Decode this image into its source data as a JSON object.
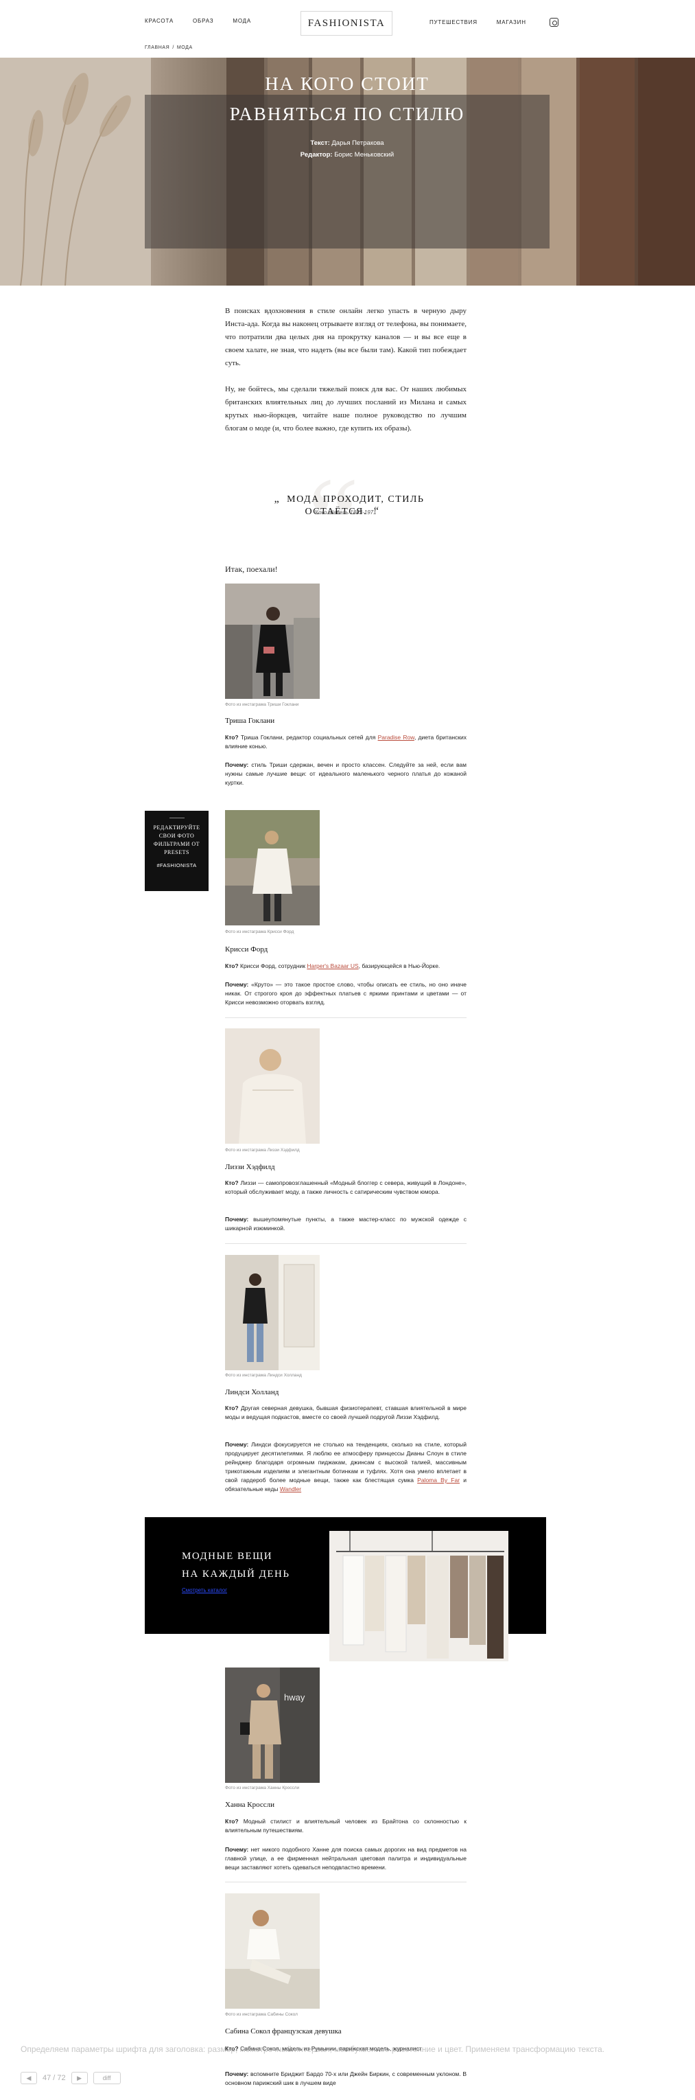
{
  "header": {
    "nav_left": [
      "КРАСОТА",
      "ОБРАЗ",
      "МОДА"
    ],
    "logo": "FASHIONISTA",
    "nav_right": [
      "ПУТЕШЕСТВИЯ",
      "МАГАЗИН"
    ],
    "breadcrumb": [
      "ГЛАВНАЯ",
      "МОДА"
    ]
  },
  "hero": {
    "title_line1": "НА КОГО СТОИТ",
    "title_line2": "РАВНЯТЬСЯ ПО СТИЛЮ",
    "author_label": "Текст:",
    "author": "Дарья Петракова",
    "editor_label": "Редактор:",
    "editor": "Борис Меньковский"
  },
  "intro": {
    "p1": "В поисках вдохновения в стиле онлайн легко упасть в черную дыру Инста-ада. Когда вы наконец отрываете взгляд от телефона, вы понимаете, что потратили два целых дня на прокрутку каналов — и вы все еще в своем халате, не зная, что надеть (вы все были там). Какой тип побеждает суть.",
    "p2": "Ну, не бойтесь, мы сделали тяжелый поиск для вас. От наших любимых британских влиятельных лиц до лучших посланий из Милана и самых крутых нью-йоркцев, читайте наше полное руководство по лучшим блогам о моде (и, что более важно, где купить их образы)."
  },
  "quote": {
    "text": "МОДА ПРОХОДИТ, СТИЛЬ ОСТАЁТСЯ.",
    "author": "Коко Шанель",
    "years": "1883-1971"
  },
  "section_intro": "Итак, поехали!",
  "people": [
    {
      "caption": "Фото из инстаграма Триши Гоклани",
      "name": "Триша Гоклани",
      "who_label": "Кто?",
      "who_text": "Триша Гоклани, редактор социальных сетей для",
      "who_link": "Paradise Row",
      "who_after": ", диета британских влияние конью.",
      "why_label": "Почему:",
      "why_text": "стиль Триши сдержан, вечен и просто классен. Следуйте за ней, если вам нужны самые лучшие вещи: от идеального маленького черного платья до кожаной куртки."
    },
    {
      "caption": "Фото из инстаграма Крисси Форд",
      "name": "Крисси Форд",
      "who_label": "Кто?",
      "who_text": "Крисси Форд, сотрудник",
      "who_link": "Harper's Bazaar US",
      "who_after": ", базирующейся в Нью-Йорке.",
      "why_label": "Почему:",
      "why_text": "«Круто» — это такое простое слово, чтобы описать ее стиль, но оно иначе никак. От строгого кроя до эффектных платьев с яркими принтами и цветами — от Крисси невозможно оторвать взгляд."
    },
    {
      "caption": "Фото из инстаграма Лиззи Хэдфилд",
      "name": "Лиззи Хэдфилд",
      "who_label": "Кто?",
      "who_text": "Лиззи — самопровозглашенный «Модный блоггер с севера, живущий в Лондоне», который обслуживает моду, а также личность с сатирическим чувством юмора.",
      "why_label": "Почему:",
      "why_text": "вышеупомянутые пункты, а также мастер-класс по мужской одежде с шикарной изюминкой."
    },
    {
      "caption": "Фото из инстаграма Линдси Холланд",
      "name": "Линдси Холланд",
      "who_label": "Кто?",
      "who_text": "Другая северная девушка, бывшая физиотерапевт, ставшая влиятельной в мире моды и ведущая подкастов, вместе со своей лучшей подругой Лиззи Хэдфилд.",
      "why_label": "Почему:",
      "why_text": "Линдси фокусируется не столько на тенденциях, сколько на стиле, который продуцирует десятилетиями. Я люблю ее атмосферу принцессы Дианы Слоун в стиле рейнджер благодаря огромным пиджакам, джинсам с высокой талией, массивным трикотажным изделиям и элегантным ботинкам и туфлях. Хотя она умело вплетает в свой гардероб более модные вещи, также как блестящая сумка",
      "why_link1": "Paloma By Far",
      "why_mid": "и обязательные кеды",
      "why_link2": "Wandler"
    },
    {
      "caption": "Фото из инстаграма Ханны Кроссли",
      "name": "Ханна Кроссли",
      "who_label": "Кто?",
      "who_text": "Модный стилист и влиятельный человек из Брайтона со склонностью к влиятельным путешествиям.",
      "why_label": "Почему:",
      "why_text": "нет никого подобного Ханне для поиска самых дорогих на вид предметов на главной улице, а ее фирменная нейтральная цветовая палитра и индивидуальные вещи заставляют хотеть одеваться неподвластно времени."
    },
    {
      "caption": "Фото из инстаграма Сабины Сокол",
      "name": "Сабина Сокол французская девушка",
      "who_label": "Кто?",
      "who_text": "Сабина Сокол, модель из Румынии, парижская модель, журналист",
      "why_label": "Почему:",
      "why_text": "вспомните Бриджит Бардо 70-х или Джейн Биркин, с современным уклоном. В основном парижский шик в лучшем виде"
    }
  ],
  "side_promo": {
    "text": "РЕДАКТИРУЙТЕ СВОИ ФОТО ФИЛЬТРАМИ ОТ PRESETS",
    "tag": "#FASHIONISTA"
  },
  "banner": {
    "title_line1": "МОДНЫЕ ВЕЩИ",
    "title_line2": "НА КАЖДЫЙ ДЕНЬ",
    "link": "Смотреть каталог"
  },
  "overlay": {
    "text": "Определяем параметры шрифта для заголовка: размер, межстрочный интервал, межбуквенное расстояние и цвет. Применяем трансформацию текста.",
    "page": "47 / 72",
    "diff": "diff"
  }
}
